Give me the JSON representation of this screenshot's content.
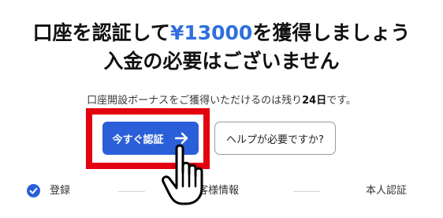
{
  "headline": {
    "line1_prefix": "口座を認証して",
    "line1_amount": "¥13000",
    "line1_suffix": "を獲得しましょう",
    "line2": "入金の必要はございません"
  },
  "subtext": {
    "prefix": "口座開設ボーナスをご獲得いただけるのは残り",
    "days": "24日",
    "suffix": "です。"
  },
  "buttons": {
    "verify_label": "今すぐ認証",
    "help_label": "ヘルプが必要ですか?"
  },
  "steps": [
    {
      "label": "登録",
      "completed": true
    },
    {
      "label": "お客様情報",
      "completed": false
    },
    {
      "label": "本人認証",
      "completed": false
    }
  ],
  "colors": {
    "accent": "#2b5fd9",
    "amount": "#2f6fde",
    "highlight_border": "#e3000f"
  },
  "icons": {
    "verify_button_icon": "arrow-right-icon",
    "step_check_icon": "check-circle-icon",
    "cursor_icon": "hand-pointer-icon"
  }
}
